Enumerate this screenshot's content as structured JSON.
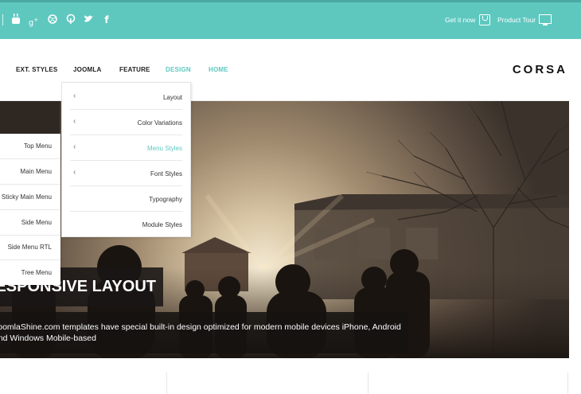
{
  "topbar": {
    "social_icons": [
      "youtube-icon",
      "google-plus-icon",
      "dribbble-icon",
      "pinterest-icon",
      "twitter-icon",
      "facebook-icon"
    ],
    "get_it_now": "Get it now",
    "product_tour": "Product Tour"
  },
  "nav": {
    "items": [
      {
        "label": "EXT. STYLES"
      },
      {
        "label": "JOOMLA"
      },
      {
        "label": "FEATURE"
      },
      {
        "label": "DESIGN",
        "active": true
      },
      {
        "label": "HOME"
      }
    ],
    "logo": "CORSA"
  },
  "design_menu": {
    "items": [
      {
        "label": "Layout",
        "has_submenu": true
      },
      {
        "label": "Color Variations",
        "has_submenu": true
      },
      {
        "label": "Menu Styles",
        "has_submenu": true,
        "active": true
      },
      {
        "label": "Font Styles",
        "has_submenu": true
      },
      {
        "label": "Typography",
        "has_submenu": false
      },
      {
        "label": "Module Styles",
        "has_submenu": false
      }
    ]
  },
  "menu_styles_submenu": {
    "items": [
      {
        "label": "Top Menu"
      },
      {
        "label": "Main Menu"
      },
      {
        "label": "Sticky Main Menu"
      },
      {
        "label": "Side Menu"
      },
      {
        "label": "Side Menu RTL"
      },
      {
        "label": "Tree Menu"
      }
    ]
  },
  "hero": {
    "title": "RESPONSIVE LAYOUT",
    "description": "JoomlaShine.com templates have special built-in design optimized for modern mobile devices iPhone, Android and Windows Mobile-based"
  },
  "colors": {
    "accent": "#5ec8bf",
    "topbar": "#5ec8bf"
  }
}
